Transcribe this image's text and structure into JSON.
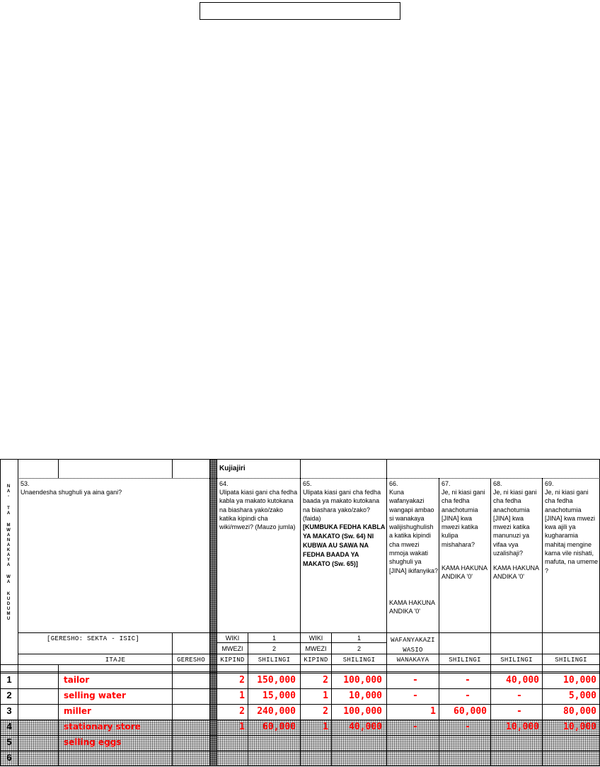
{
  "section_title": "Kujiajiri",
  "vertical_label": [
    "N",
    "A",
    "-",
    "T",
    "A",
    "M",
    "W",
    "A",
    "N",
    "A",
    "K",
    "A",
    "Y",
    "A",
    "W",
    "A",
    "K",
    "U",
    "D",
    "U",
    "M",
    "U"
  ],
  "q53": {
    "num": "53.",
    "text": "Unaendesha shughuli ya aina gani?",
    "code_note": "[GERESHO: SEKTA - ISIC]",
    "col_itaje": "ITAJE",
    "col_geresho": "GERESHO"
  },
  "q64": {
    "num": "64.",
    "text": "Ulipata kiasi gani cha fedha kabla ya makato kutokana na biashara yako/zako katika kipindi cha wiki/mwezi?  (Mauzo jumla)",
    "wiki": "WIKI",
    "wiki_code": "1",
    "mwezi": "MWEZI",
    "mwezi_code": "2",
    "col_a": "KIPIND",
    "col_b": "SHILINGI"
  },
  "q65": {
    "num": "65.",
    "text": "Ulipata kiasi gani cha fedha baada ya makato kutokana na biashara yako/zako? (faida)",
    "note": "[KUMBUKA FEDHA KABLA YA MAKATO (Sw. 64) NI KUBWA AU SAWA NA FEDHA BAADA YA MAKATO (Sw. 65)]",
    "wiki": "WIKI",
    "wiki_code": "1",
    "mwezi": "MWEZI",
    "mwezi_code": "2",
    "col_a": "KIPIND",
    "col_b": "SHILINGI"
  },
  "q66": {
    "num": "66.",
    "text": "Kuna wafanyakazi wangapi ambao si wanakaya walijishughulish a katika kipindi cha mwezi mmoja wakati shughuli ya [JINA] ikifanyika?",
    "note": "KAMA HAKUNA ANDIKA '0'",
    "head1": "WAFANYAKAZI",
    "head2": "WASIO",
    "col": "WANAKAYA"
  },
  "q67": {
    "num": "67.",
    "text": "Je, ni kiasi gani cha fedha anachotumia [JINA] kwa mwezi katika kulipa mishahara?",
    "note": "KAMA HAKUNA ANDIKA '0'",
    "col": "SHILINGI"
  },
  "q68": {
    "num": "68.",
    "text": "Je, ni kiasi gani cha fedha anachotumia [JINA] kwa mwezi katika manunuzi ya vifaa vya uzalishaji?",
    "note": "KAMA HAKUNA ANDIKA '0'",
    "col": "SHILINGI"
  },
  "q69": {
    "num": "69.",
    "text": "Je, ni kiasi gani cha fedha anachotumia [JINA] kwa mwezi kwa ajili ya kugharamia mahitaj mengine kama vile nishati, mafuta, na umeme ?",
    "col": "SHILINGI"
  },
  "rows": [
    {
      "n": "1",
      "activity": "tailor",
      "k64": "2",
      "s64": "150,000",
      "k65": "2",
      "s65": "100,000",
      "w66": "-",
      "s67": "-",
      "s68": "40,000",
      "s69": "10,000"
    },
    {
      "n": "2",
      "activity": "selling water",
      "k64": "1",
      "s64": "15,000",
      "k65": "1",
      "s65": "10,000",
      "w66": "-",
      "s67": "-",
      "s68": "-",
      "s69": "5,000"
    },
    {
      "n": "3",
      "activity": "miller",
      "k64": "2",
      "s64": "240,000",
      "k65": "2",
      "s65": "100,000",
      "w66": "1",
      "s67": "60,000",
      "s68": "-",
      "s69": "80,000"
    },
    {
      "n": "4",
      "activity": "stationary store",
      "k64": "1",
      "s64": "60,000",
      "k65": "1",
      "s65": "40,000",
      "w66": "-",
      "s67": "-",
      "s68": "10,000",
      "s69": "10,000"
    },
    {
      "n": "5",
      "activity": "selling eggs",
      "k64": "",
      "s64": "",
      "k65": "",
      "s65": "",
      "w66": "",
      "s67": "",
      "s68": "",
      "s69": ""
    },
    {
      "n": "6",
      "activity": "",
      "k64": "",
      "s64": "",
      "k65": "",
      "s65": "",
      "w66": "",
      "s67": "",
      "s68": "",
      "s69": ""
    }
  ]
}
